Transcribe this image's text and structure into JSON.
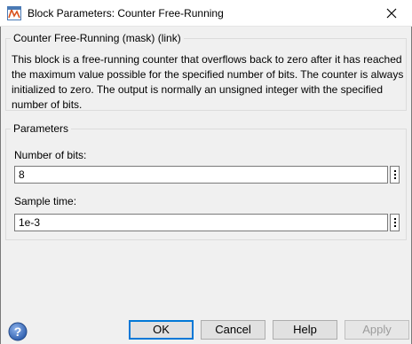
{
  "window": {
    "title": "Block Parameters: Counter Free-Running"
  },
  "description": {
    "group_title": "Counter Free-Running (mask) (link)",
    "text": "This block is a free-running counter that overflows back to zero after it has reached the maximum value possible for the specified number of bits. The counter is always initialized to zero. The output is normally an unsigned integer with the specified number of bits."
  },
  "parameters": {
    "group_title": "Parameters",
    "fields": [
      {
        "label": "Number of bits:",
        "value": "8"
      },
      {
        "label": "Sample time:",
        "value": "1e-3"
      }
    ]
  },
  "buttons": {
    "ok": "OK",
    "cancel": "Cancel",
    "help": "Help",
    "apply": "Apply"
  },
  "icons": {
    "app": "simulink-block-icon",
    "close": "close-icon",
    "help": "question-mark-icon",
    "field_menu": "vertical-ellipsis-icon"
  },
  "colors": {
    "accent": "#0078d7",
    "help_icon": "#3c6fc0"
  }
}
